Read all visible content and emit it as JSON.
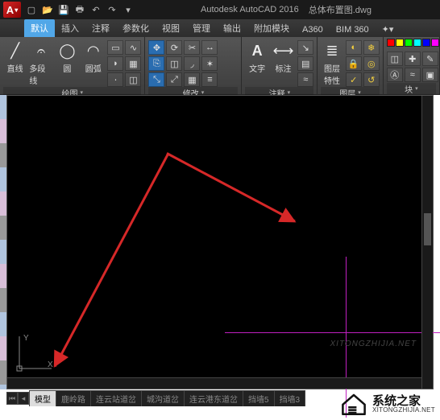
{
  "title": {
    "app": "Autodesk AutoCAD 2016",
    "doc": "总体布置图.dwg"
  },
  "qat": [
    "new",
    "open",
    "save",
    "print",
    "undo",
    "redo"
  ],
  "tabs": [
    "默认",
    "插入",
    "注释",
    "参数化",
    "视图",
    "管理",
    "输出",
    "附加模块",
    "A360",
    "BIM 360"
  ],
  "active_tab": 0,
  "panels": {
    "draw": {
      "title": "绘图",
      "items": {
        "line": "直线",
        "polyline": "多段线",
        "circle": "圆",
        "arc": "圆弧"
      }
    },
    "modify": {
      "title": "修改"
    },
    "annot": {
      "title": "注释",
      "items": {
        "text": "文字",
        "dim": "标注"
      }
    },
    "layers": {
      "title": "图层",
      "items": {
        "props": "图层\n特性"
      }
    },
    "block": {
      "title": "块"
    }
  },
  "ucs": {
    "x": "X",
    "y": "Y"
  },
  "model_tabs": [
    "模型",
    "鹿岭路",
    "连云站道岔",
    "城沟道岔",
    "连云港东道岔",
    "挡墙5",
    "挡墙3"
  ],
  "active_model_tab": 0,
  "watermark": "XITONGZHIJIA.NET",
  "brand": {
    "cn": "系统之家",
    "en": "XITONGZHIJIA.NET"
  },
  "colors": {
    "accent": "#51a7e8",
    "arrow": "#d62828",
    "crosshair": "#c020c0"
  }
}
